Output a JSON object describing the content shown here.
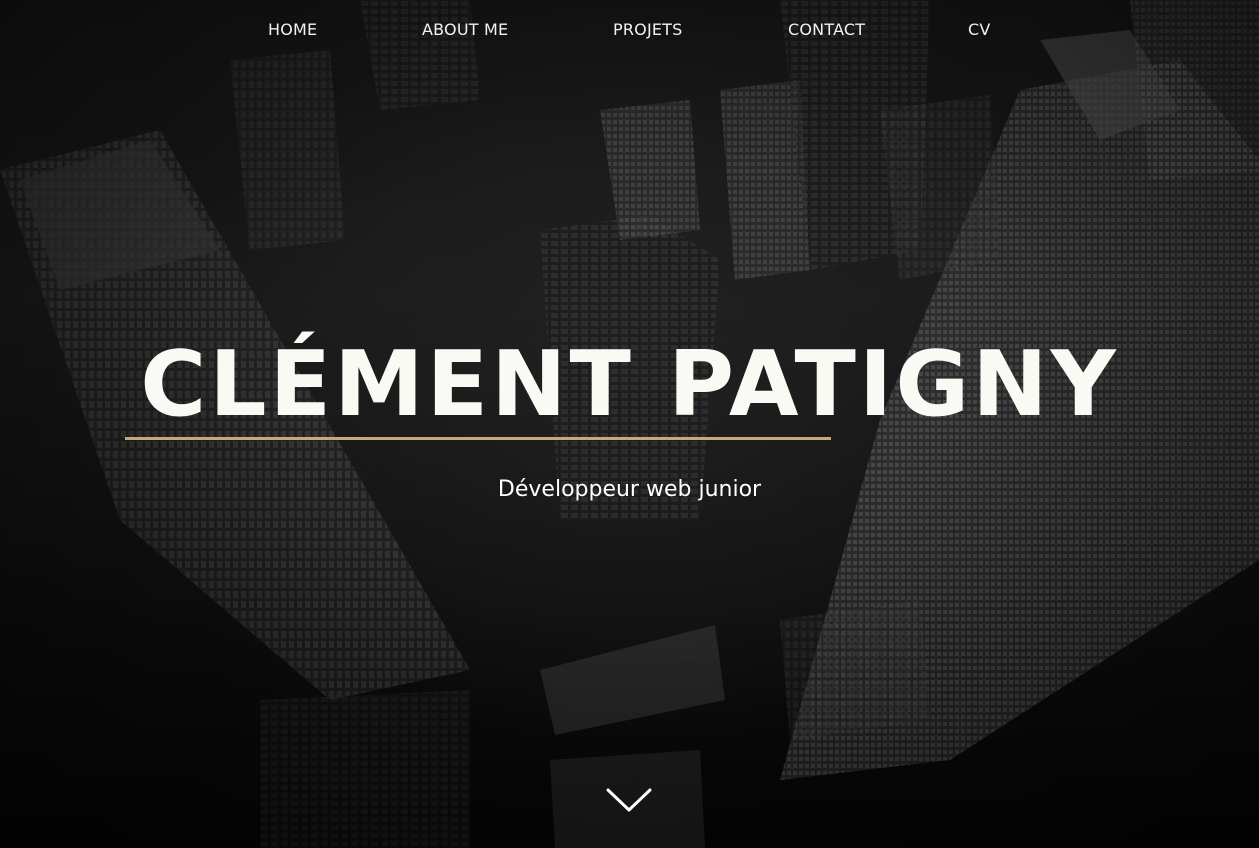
{
  "nav": {
    "items": [
      {
        "label": "HOME"
      },
      {
        "label": "ABOUT ME"
      },
      {
        "label": "PROJETS"
      },
      {
        "label": "CONTACT"
      },
      {
        "label": "CV"
      }
    ]
  },
  "hero": {
    "title": "CLÉMENT PATIGNY",
    "subtitle": "Développeur web junior",
    "scroll_icon": "chevron-down-icon",
    "background": "aerial-city-skyscrapers-photo"
  },
  "colors": {
    "accent": "#c9a77c",
    "text": "#ffffff",
    "background": "#0a0a0a"
  }
}
